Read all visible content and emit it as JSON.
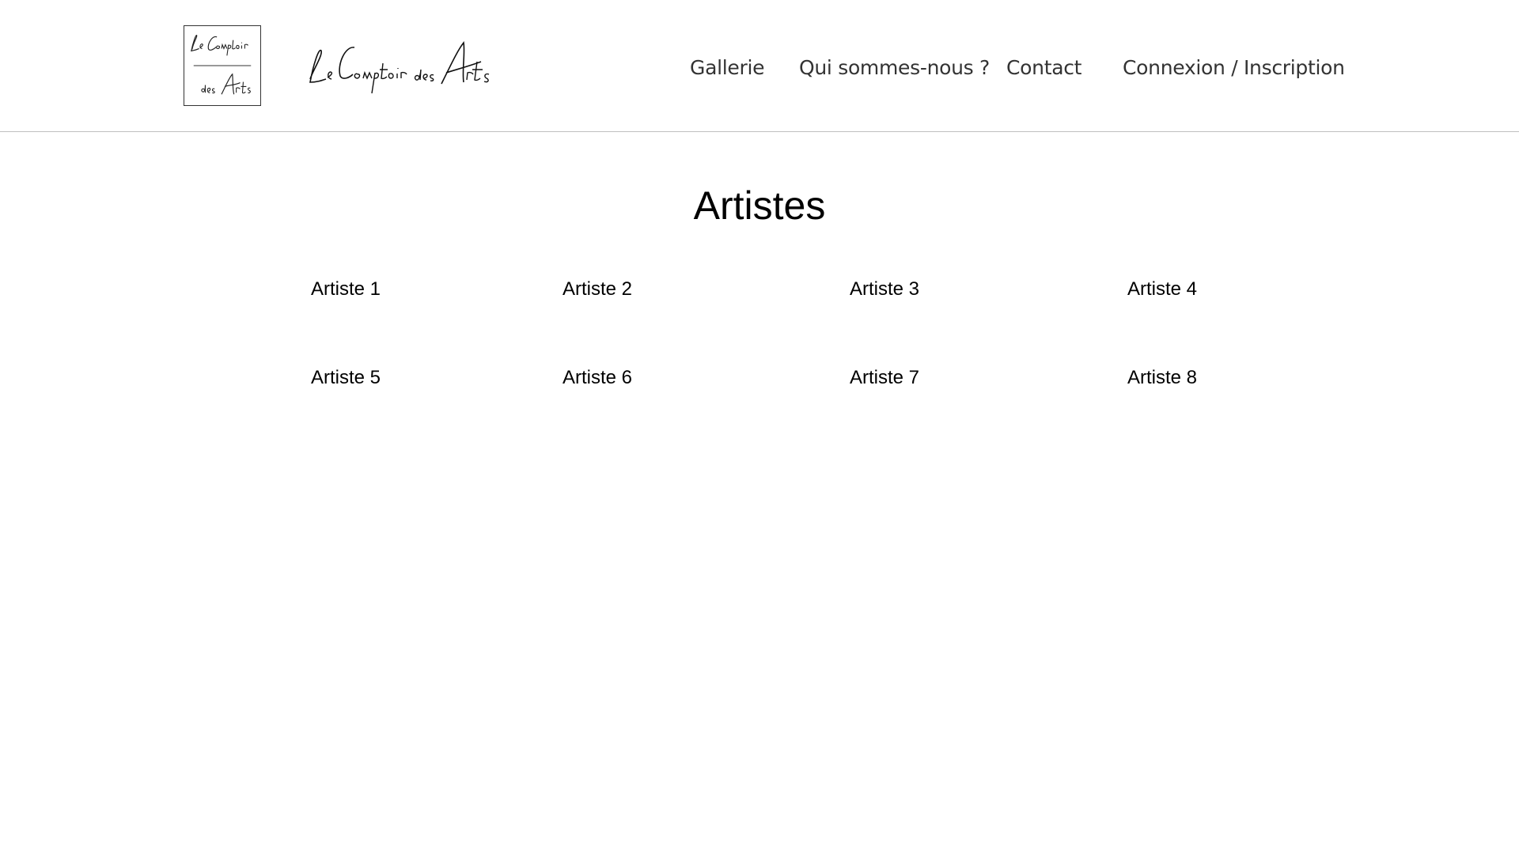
{
  "header": {
    "logo_box_lines": [
      "Le Comptoir",
      "des Arts"
    ],
    "logo_script": "Le Comptoir des Arts",
    "nav": [
      {
        "label": "Gallerie"
      },
      {
        "label": "Qui sommes-nous ?"
      },
      {
        "label": "Contact"
      },
      {
        "label": "Connexion / Inscription"
      }
    ]
  },
  "main": {
    "title": "Artistes",
    "artists": [
      {
        "label": "Artiste 1"
      },
      {
        "label": "Artiste 2"
      },
      {
        "label": "Artiste 3"
      },
      {
        "label": "Artiste 4"
      },
      {
        "label": "Artiste 5"
      },
      {
        "label": "Artiste 6"
      },
      {
        "label": "Artiste 7"
      },
      {
        "label": "Artiste 8"
      }
    ]
  },
  "colors": {
    "background": "#ffffff",
    "text": "#000000",
    "nav_text": "#333333",
    "divider": "#bfbfbf"
  }
}
